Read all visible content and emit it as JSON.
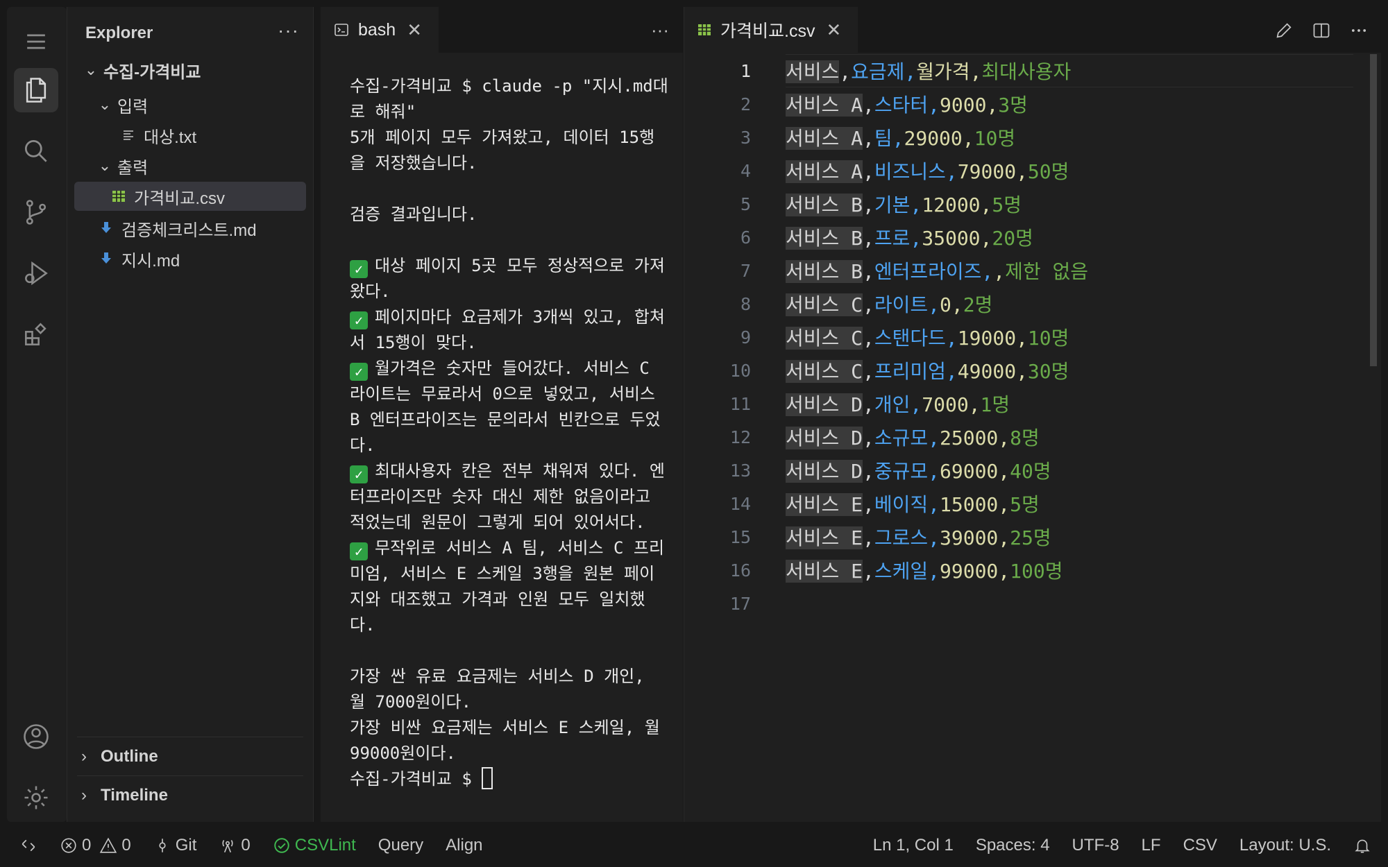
{
  "sidebar": {
    "title": "Explorer",
    "more": "···",
    "root": "수집-가격비교",
    "folder_input": "입력",
    "file_target": "대상.txt",
    "folder_output": "출력",
    "file_csv": "가격비교.csv",
    "file_checklist": "검증체크리스트.md",
    "file_instructions": "지시.md",
    "outline": "Outline",
    "timeline": "Timeline"
  },
  "terminal": {
    "tab": "bash",
    "more": "···",
    "lines": [
      "수집-가격비교 $ claude -p \"지시.md대로 해줘\"",
      "5개 페이지 모두 가져왔고, 데이터 15행을 저장했습니다.",
      "",
      "검증 결과입니다.",
      "",
      "대상 페이지 5곳 모두 정상적으로 가져왔다.",
      "페이지마다 요금제가 3개씩 있고, 합쳐서 15행이 맞다.",
      "월가격은 숫자만 들어갔다. 서비스 C 라이트는 무료라서 0으로 넣었고, 서비스 B 엔터프라이즈는 문의라서 빈칸으로 두었다.",
      "최대사용자 칸은 전부 채워져 있다. 엔터프라이즈만 숫자 대신 제한 없음이라고 적었는데 원문이 그렇게 되어 있어서다.",
      "무작위로 서비스 A 팀, 서비스 C 프리미엄, 서비스 E 스케일 3행을 원본 페이지와 대조했고 가격과 인원 모두 일치했다.",
      "",
      "가장 싼 유료 요금제는 서비스 D 개인, 월 7000원이다.",
      "가장 비싼 요금제는 서비스 E 스케일, 월 99000원이다.",
      "수집-가격비교 $ "
    ]
  },
  "editor": {
    "tab": "가격비교.csv",
    "header": [
      "서비스",
      "요금제",
      "월가격",
      "최대사용자"
    ],
    "rows": [
      [
        "서비스 A",
        "스타터",
        "9000",
        "3명"
      ],
      [
        "서비스 A",
        "팀",
        "29000",
        "10명"
      ],
      [
        "서비스 A",
        "비즈니스",
        "79000",
        "50명"
      ],
      [
        "서비스 B",
        "기본",
        "12000",
        "5명"
      ],
      [
        "서비스 B",
        "프로",
        "35000",
        "20명"
      ],
      [
        "서비스 B",
        "엔터프라이즈",
        "",
        "제한 없음"
      ],
      [
        "서비스 C",
        "라이트",
        "0",
        "2명"
      ],
      [
        "서비스 C",
        "스탠다드",
        "19000",
        "10명"
      ],
      [
        "서비스 C",
        "프리미엄",
        "49000",
        "30명"
      ],
      [
        "서비스 D",
        "개인",
        "7000",
        "1명"
      ],
      [
        "서비스 D",
        "소규모",
        "25000",
        "8명"
      ],
      [
        "서비스 D",
        "중규모",
        "69000",
        "40명"
      ],
      [
        "서비스 E",
        "베이직",
        "15000",
        "5명"
      ],
      [
        "서비스 E",
        "그로스",
        "39000",
        "25명"
      ],
      [
        "서비스 E",
        "스케일",
        "99000",
        "100명"
      ]
    ],
    "last_line": "17",
    "colors": {
      "col1": "#d4d4d4",
      "col2": "#4ea3f2",
      "col3": "#dcdcaa",
      "col4": "#6aab4a"
    }
  },
  "status": {
    "errors": "0",
    "warnings": "0",
    "git": "Git",
    "ports": "0",
    "csvlint": "CSVLint",
    "query": "Query",
    "align": "Align",
    "position": "Ln 1, Col 1",
    "spaces": "Spaces: 4",
    "encoding": "UTF-8",
    "eol": "LF",
    "language": "CSV",
    "layout": "Layout: U.S."
  }
}
